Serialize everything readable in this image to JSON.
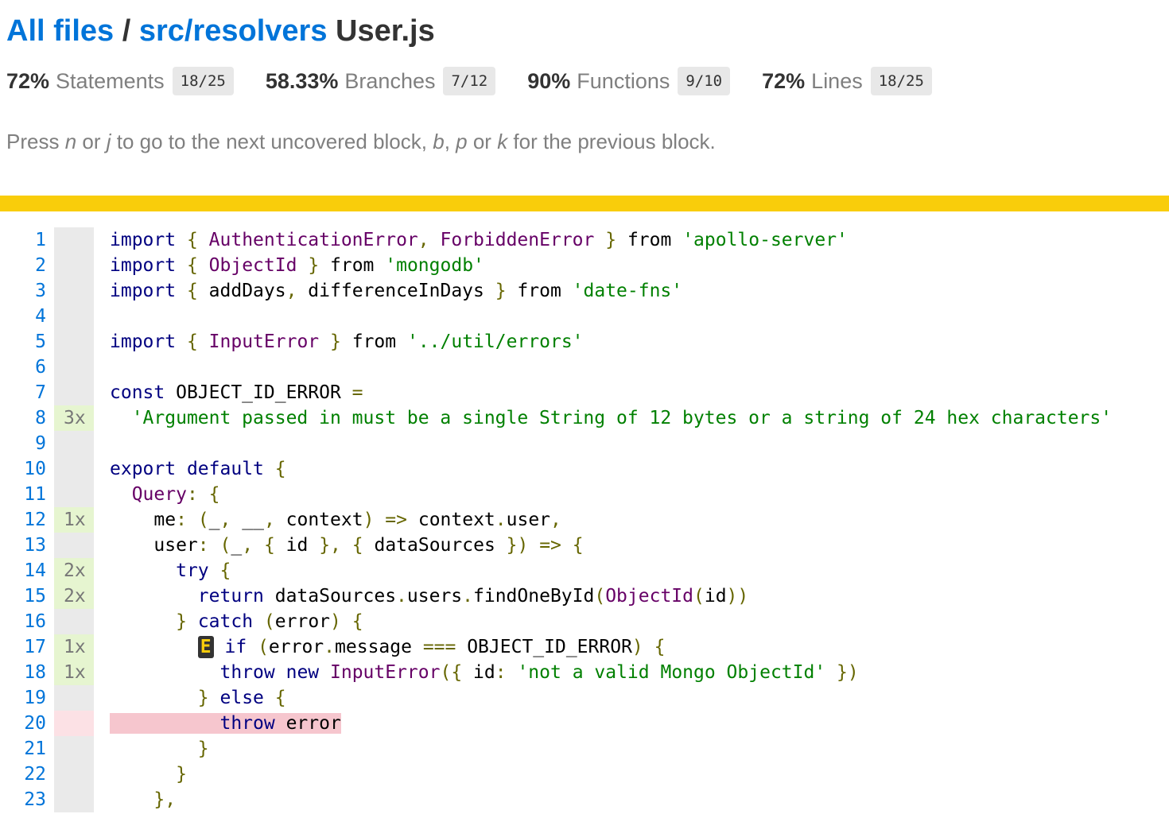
{
  "breadcrumb": {
    "all_files": "All files",
    "separator": "/",
    "dir": "src/resolvers",
    "file": "User.js"
  },
  "stats": [
    {
      "pct": "72%",
      "label": "Statements",
      "fraction": "18/25"
    },
    {
      "pct": "58.33%",
      "label": "Branches",
      "fraction": "7/12"
    },
    {
      "pct": "90%",
      "label": "Functions",
      "fraction": "9/10"
    },
    {
      "pct": "72%",
      "label": "Lines",
      "fraction": "18/25"
    }
  ],
  "hint": {
    "p1": "Press ",
    "k1": "n",
    "p2": " or ",
    "k2": "j",
    "p3": " to go to the next uncovered block, ",
    "k3": "b",
    "p4": ", ",
    "k4": "p",
    "p5": " or ",
    "k5": "k",
    "p6": " for the previous block."
  },
  "colors": {
    "link": "#0074d9",
    "status_bar": "#f9cd0b",
    "covered": "#e6f5d0",
    "uncovered_line": "#f6c6ce",
    "neutral_gutter": "#eaeaea"
  },
  "branch_marker": "E",
  "lines": [
    {
      "n": "1",
      "count": "",
      "cov": "neutral",
      "tokens": [
        [
          "kw",
          "import"
        ],
        [
          "",
          " "
        ],
        [
          "pun",
          "{"
        ],
        [
          "",
          " "
        ],
        [
          "cls",
          "AuthenticationError"
        ],
        [
          "pun",
          ","
        ],
        [
          "",
          " "
        ],
        [
          "cls",
          "ForbiddenError"
        ],
        [
          "",
          " "
        ],
        [
          "pun",
          "}"
        ],
        [
          "",
          " from "
        ],
        [
          "str",
          "'apollo-server'"
        ]
      ]
    },
    {
      "n": "2",
      "count": "",
      "cov": "neutral",
      "tokens": [
        [
          "kw",
          "import"
        ],
        [
          "",
          " "
        ],
        [
          "pun",
          "{"
        ],
        [
          "",
          " "
        ],
        [
          "cls",
          "ObjectId"
        ],
        [
          "",
          " "
        ],
        [
          "pun",
          "}"
        ],
        [
          "",
          " from "
        ],
        [
          "str",
          "'mongodb'"
        ]
      ]
    },
    {
      "n": "3",
      "count": "",
      "cov": "neutral",
      "tokens": [
        [
          "kw",
          "import"
        ],
        [
          "",
          " "
        ],
        [
          "pun",
          "{"
        ],
        [
          "",
          " addDays"
        ],
        [
          "pun",
          ","
        ],
        [
          "",
          " differenceInDays "
        ],
        [
          "pun",
          "}"
        ],
        [
          "",
          " from "
        ],
        [
          "str",
          "'date-fns'"
        ]
      ]
    },
    {
      "n": "4",
      "count": "",
      "cov": "neutral",
      "tokens": []
    },
    {
      "n": "5",
      "count": "",
      "cov": "neutral",
      "tokens": [
        [
          "kw",
          "import"
        ],
        [
          "",
          " "
        ],
        [
          "pun",
          "{"
        ],
        [
          "",
          " "
        ],
        [
          "cls",
          "InputError"
        ],
        [
          "",
          " "
        ],
        [
          "pun",
          "}"
        ],
        [
          "",
          " from "
        ],
        [
          "str",
          "'../util/errors'"
        ]
      ]
    },
    {
      "n": "6",
      "count": "",
      "cov": "neutral",
      "tokens": []
    },
    {
      "n": "7",
      "count": "",
      "cov": "neutral",
      "tokens": [
        [
          "kw",
          "const"
        ],
        [
          "",
          " OBJECT_ID_ERROR "
        ],
        [
          "pun",
          "="
        ]
      ]
    },
    {
      "n": "8",
      "count": "3x",
      "cov": "yes",
      "tokens": [
        [
          "",
          "  "
        ],
        [
          "str",
          "'Argument passed in must be a single String of 12 bytes or a string of 24 hex characters'"
        ]
      ]
    },
    {
      "n": "9",
      "count": "",
      "cov": "neutral",
      "tokens": []
    },
    {
      "n": "10",
      "count": "",
      "cov": "neutral",
      "tokens": [
        [
          "kw",
          "export"
        ],
        [
          "",
          " "
        ],
        [
          "kw",
          "default"
        ],
        [
          "",
          " "
        ],
        [
          "pun",
          "{"
        ]
      ]
    },
    {
      "n": "11",
      "count": "",
      "cov": "neutral",
      "tokens": [
        [
          "",
          "  "
        ],
        [
          "cls",
          "Query"
        ],
        [
          "pun",
          ":"
        ],
        [
          "",
          " "
        ],
        [
          "pun",
          "{"
        ]
      ]
    },
    {
      "n": "12",
      "count": "1x",
      "cov": "yes",
      "tokens": [
        [
          "",
          "    me"
        ],
        [
          "pun",
          ":"
        ],
        [
          "",
          " "
        ],
        [
          "pun",
          "("
        ],
        [
          "",
          "_"
        ],
        [
          "pun",
          ","
        ],
        [
          "",
          " __"
        ],
        [
          "pun",
          ","
        ],
        [
          "",
          " context"
        ],
        [
          "pun",
          ")"
        ],
        [
          "",
          " "
        ],
        [
          "pun",
          "=>"
        ],
        [
          "",
          " context"
        ],
        [
          "pun",
          "."
        ],
        [
          "",
          "user"
        ],
        [
          "pun",
          ","
        ]
      ]
    },
    {
      "n": "13",
      "count": "",
      "cov": "neutral",
      "tokens": [
        [
          "",
          "    user"
        ],
        [
          "pun",
          ":"
        ],
        [
          "",
          " "
        ],
        [
          "pun",
          "("
        ],
        [
          "",
          "_"
        ],
        [
          "pun",
          ","
        ],
        [
          "",
          " "
        ],
        [
          "pun",
          "{"
        ],
        [
          "",
          " id "
        ],
        [
          "pun",
          "}"
        ],
        [
          "pun",
          ","
        ],
        [
          "",
          " "
        ],
        [
          "pun",
          "{"
        ],
        [
          "",
          " dataSources "
        ],
        [
          "pun",
          "})"
        ],
        [
          "",
          " "
        ],
        [
          "pun",
          "=>"
        ],
        [
          "",
          " "
        ],
        [
          "pun",
          "{"
        ]
      ]
    },
    {
      "n": "14",
      "count": "2x",
      "cov": "yes",
      "tokens": [
        [
          "",
          "      "
        ],
        [
          "kw",
          "try"
        ],
        [
          "",
          " "
        ],
        [
          "pun",
          "{"
        ]
      ]
    },
    {
      "n": "15",
      "count": "2x",
      "cov": "yes",
      "tokens": [
        [
          "",
          "        "
        ],
        [
          "kw",
          "return"
        ],
        [
          "",
          " dataSources"
        ],
        [
          "pun",
          "."
        ],
        [
          "",
          "users"
        ],
        [
          "pun",
          "."
        ],
        [
          "",
          "findOneById"
        ],
        [
          "pun",
          "("
        ],
        [
          "cls",
          "ObjectId"
        ],
        [
          "pun",
          "("
        ],
        [
          "",
          "id"
        ],
        [
          "pun",
          "))"
        ]
      ]
    },
    {
      "n": "16",
      "count": "",
      "cov": "neutral",
      "tokens": [
        [
          "",
          "      "
        ],
        [
          "pun",
          "}"
        ],
        [
          "",
          " "
        ],
        [
          "kw",
          "catch"
        ],
        [
          "",
          " "
        ],
        [
          "pun",
          "("
        ],
        [
          "",
          "error"
        ],
        [
          "pun",
          ")"
        ],
        [
          "",
          " "
        ],
        [
          "pun",
          "{"
        ]
      ]
    },
    {
      "n": "17",
      "count": "1x",
      "cov": "yes",
      "branch": true,
      "tokens": [
        [
          "",
          " "
        ],
        [
          "kw",
          "if"
        ],
        [
          "",
          " "
        ],
        [
          "pun",
          "("
        ],
        [
          "",
          "error"
        ],
        [
          "pun",
          "."
        ],
        [
          "",
          "message "
        ],
        [
          "pun",
          "==="
        ],
        [
          "",
          " OBJECT_ID_ERROR"
        ],
        [
          "pun",
          ")"
        ],
        [
          "",
          " "
        ],
        [
          "pun",
          "{"
        ]
      ]
    },
    {
      "n": "18",
      "count": "1x",
      "cov": "yes",
      "tokens": [
        [
          "",
          "          "
        ],
        [
          "kw",
          "throw"
        ],
        [
          "",
          " "
        ],
        [
          "kw",
          "new"
        ],
        [
          "",
          " "
        ],
        [
          "cls",
          "InputError"
        ],
        [
          "pun",
          "({"
        ],
        [
          "",
          " id"
        ],
        [
          "pun",
          ":"
        ],
        [
          "",
          " "
        ],
        [
          "str",
          "'not a valid Mongo ObjectId'"
        ],
        [
          "",
          " "
        ],
        [
          "pun",
          "})"
        ]
      ]
    },
    {
      "n": "19",
      "count": "",
      "cov": "neutral",
      "tokens": [
        [
          "",
          "        "
        ],
        [
          "pun",
          "}"
        ],
        [
          "",
          " "
        ],
        [
          "kw",
          "else"
        ],
        [
          "",
          " "
        ],
        [
          "pun",
          "{"
        ]
      ]
    },
    {
      "n": "20",
      "count": "",
      "cov": "no",
      "uncovered": true,
      "tokens": [
        [
          "",
          "          "
        ],
        [
          "kw",
          "throw"
        ],
        [
          "",
          " error"
        ]
      ]
    },
    {
      "n": "21",
      "count": "",
      "cov": "neutral",
      "tokens": [
        [
          "",
          "        "
        ],
        [
          "pun",
          "}"
        ]
      ]
    },
    {
      "n": "22",
      "count": "",
      "cov": "neutral",
      "tokens": [
        [
          "",
          "      "
        ],
        [
          "pun",
          "}"
        ]
      ]
    },
    {
      "n": "23",
      "count": "",
      "cov": "neutral",
      "tokens": [
        [
          "",
          "    "
        ],
        [
          "pun",
          "},"
        ]
      ]
    }
  ]
}
